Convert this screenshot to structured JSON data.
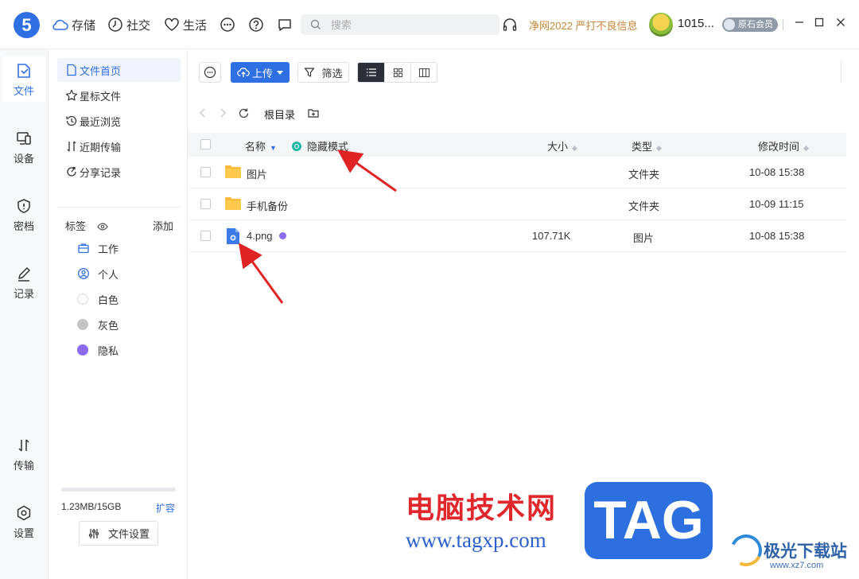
{
  "app": {
    "logo": "5",
    "nav": [
      {
        "label": "存储",
        "icon": "cloud-icon"
      },
      {
        "label": "社交",
        "icon": "clock-icon"
      },
      {
        "label": "生活",
        "icon": "heart-icon"
      }
    ],
    "search_placeholder": "搜索",
    "promo": "净网2022 严打不良信息",
    "username": "1015...",
    "member_badge": "原石会员"
  },
  "rail": [
    {
      "label": "文件",
      "icon": "file-icon",
      "active": true
    },
    {
      "label": "设备",
      "icon": "device-icon"
    },
    {
      "label": "密档",
      "icon": "shield-icon"
    },
    {
      "label": "记录",
      "icon": "pen-icon"
    },
    {
      "label": "传输",
      "icon": "transfer-icon"
    },
    {
      "label": "设置",
      "icon": "settings-icon"
    }
  ],
  "side": {
    "items": [
      {
        "label": "文件首页",
        "icon": "document-icon"
      },
      {
        "label": "星标文件",
        "icon": "star-icon"
      },
      {
        "label": "最近浏览",
        "icon": "history-icon"
      },
      {
        "label": "近期传输",
        "icon": "transfer-icon"
      },
      {
        "label": "分享记录",
        "icon": "share-icon"
      }
    ],
    "tags_title": "标签",
    "tags_add": "添加",
    "tags": [
      {
        "label": "工作",
        "icon": "briefcase-icon"
      },
      {
        "label": "个人",
        "icon": "person-icon"
      },
      {
        "label": "白色",
        "color": "#ffffff"
      },
      {
        "label": "灰色",
        "color": "#c4c4c4"
      },
      {
        "label": "隐私",
        "color": "#8b6cf0"
      }
    ],
    "storage_text": "1.23MB/15GB",
    "storage_used_fraction": 0.0001,
    "expand_label": "扩容",
    "file_settings": "文件设置"
  },
  "toolbar": {
    "upload": "上传",
    "filter": "筛选"
  },
  "path": {
    "root": "根目录"
  },
  "table": {
    "headers": {
      "name": "名称",
      "hide_mode": "隐藏模式",
      "size": "大小",
      "type": "类型",
      "modified": "修改时间"
    },
    "rows": [
      {
        "name": "图片",
        "size": "",
        "type": "文件夹",
        "modified": "10-08 15:38",
        "kind": "folder"
      },
      {
        "name": "手机备份",
        "size": "",
        "type": "文件夹",
        "modified": "10-09 11:15",
        "kind": "folder"
      },
      {
        "name": "4.png",
        "size": "107.71K",
        "type": "图片",
        "modified": "10-08 15:38",
        "kind": "image",
        "tag_color": "#8b6cf0"
      }
    ]
  },
  "watermark": {
    "cn": "电脑技术网",
    "url": "www.tagxp.com",
    "tag": "TAG",
    "site": "极光下载站",
    "site_url": "www.xz7.com"
  }
}
